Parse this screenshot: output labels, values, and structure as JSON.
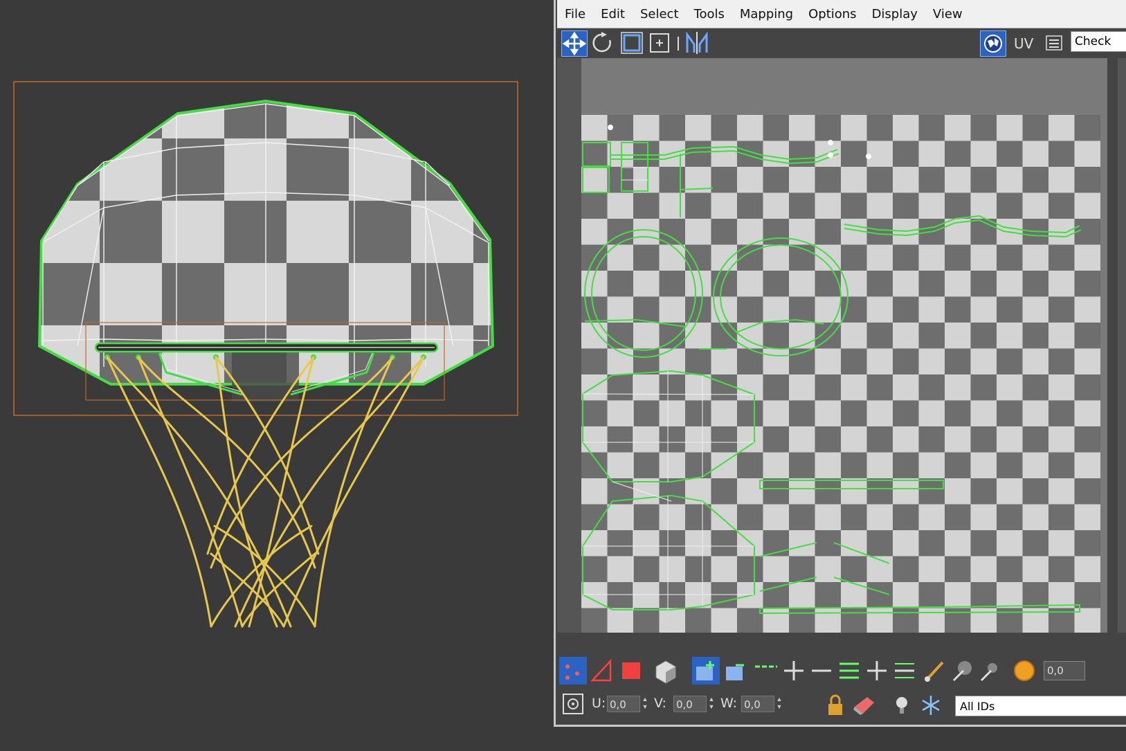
{
  "menubar": {
    "items": [
      "File",
      "Edit",
      "Select",
      "Tools",
      "Mapping",
      "Options",
      "Display",
      "View"
    ]
  },
  "toolbar": {
    "uv_label": "UV",
    "checker_label": "Check"
  },
  "bottom_toolbar": {
    "u_label": "U:",
    "u_value": "0,0",
    "v_label": "V:",
    "v_value": "0,0",
    "w_label": "W:",
    "w_value": "0,0",
    "value_field": "0,0",
    "ids_select": "All IDs"
  },
  "colors": {
    "viewport_bg": "#3a3a3a",
    "selection_green": "#44dd44",
    "net_yellow": "#e8c84a",
    "bounding_box": "#c06a2a",
    "active_button": "#2a63c4",
    "checker_light": "#d4d4d4",
    "checker_dark": "#6e6e6e"
  }
}
